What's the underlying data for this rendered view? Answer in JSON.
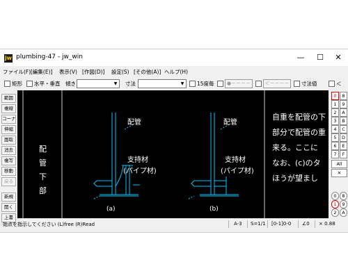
{
  "window": {
    "title": "plumbing-47 - jw_win"
  },
  "titlebar_buttons": {
    "minimize": "—",
    "maximize": "☐",
    "close": "✕"
  },
  "menu": [
    "ファイル(F)",
    "[編集(E)]",
    "表示(V)",
    "[作図(D)]",
    "設定(S)",
    "[その他(A)]",
    "ヘルプ(H)"
  ],
  "toolbar": {
    "rect_label": "矩形",
    "hv_label": "水平・垂直",
    "tilt_label": "傾き",
    "dim_label": "寸法",
    "deg15_label": "15度毎",
    "btn1_label": "●－－－－",
    "btn2_label": "＜－－－－",
    "dim_value_label": "寸法値",
    "lt_label": "＜"
  },
  "left_tools": [
    "範囲",
    "複線",
    "コーナー",
    "伸縮",
    "面取",
    "消去",
    "複写",
    "移動",
    "戻る",
    "新規",
    "開く",
    "上書"
  ],
  "right_tools": {
    "col1": [
      "0",
      "1",
      "2",
      "3",
      "4",
      "5",
      "6",
      "7"
    ],
    "col2": [
      "8",
      "9",
      "A",
      "B",
      "C",
      "D",
      "E",
      "F"
    ],
    "all": "All",
    "x": "✕",
    "bottom1": [
      "0",
      "1",
      "2"
    ],
    "bottom2": [
      "8",
      "9",
      "A"
    ]
  },
  "drawing": {
    "vertical_label_chars": [
      "配",
      "管",
      "下",
      "部"
    ],
    "label_pipe_a": "配管",
    "label_support_a": "支持材",
    "label_pipe_material_a": "(パイプ材)",
    "label_pipe_b": "配管",
    "label_support_b": "支持材",
    "label_pipe_material_b": "(パイプ材)",
    "caption_a": "(a)",
    "caption_b": "(b)",
    "text_lines": [
      "自重を配管の下",
      "部分で配管の重",
      "来る。ここに",
      "なお、(c)のタ",
      "ほうが望まし"
    ],
    "colors": {
      "line": "#00c8ff",
      "text": "#ffffff",
      "background": "#000000"
    }
  },
  "status": {
    "message": "始点を指示してください (L)free (R)Read",
    "paper": "A-3",
    "scale": "S=1/1",
    "layer": "[0-1]0-0",
    "angle": "∠0",
    "zoom": "× 0.88"
  }
}
